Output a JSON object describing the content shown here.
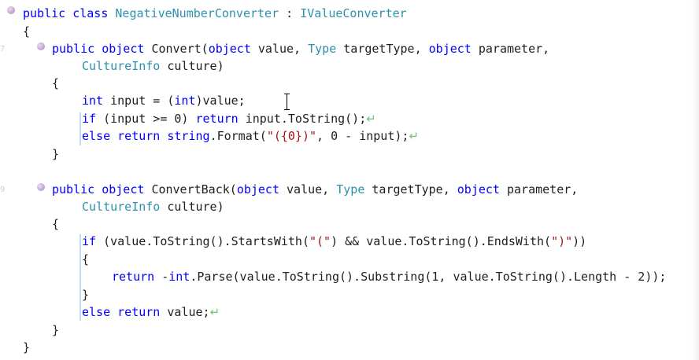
{
  "editor": {
    "line_numbers": [
      "7",
      "9"
    ],
    "tokens": {
      "public": "public",
      "class": "class",
      "class_name": "NegativeNumberConverter",
      "colon": " : ",
      "interface_name": "IValueConverter",
      "brace_open": "{",
      "brace_close": "}",
      "object": "object",
      "convert_name": "Convert(",
      "convert_back_name": "ConvertBack(",
      "type": "Type",
      "culture_info": "CultureInfo",
      "value_comma": " value, ",
      "target_type_comma": " targetType, ",
      "parameter_comma": " parameter,",
      "culture_close": " culture)",
      "int": "int",
      "input_assign": " input = (",
      "int_cast_close": ")value;",
      "if": "if",
      "input_ge_zero": " (input >= 0) ",
      "return": "return",
      "input_tostring": " input.ToString();",
      "else": "else",
      "string": "string",
      "format_open": ".Format(",
      "format_string": "\"({0})\"",
      "format_rest": ", 0 - input);",
      "if_starts_with": " (value.ToString().StartsWith(",
      "open_paren_string": "\"(\"",
      "ends_with": ") && value.ToString().EndsWith(",
      "close_paren_string": "\")\"",
      "double_close": "))",
      "neg": " -",
      "parse_call": ".Parse(value.ToString().Substring(1, value.ToString().Length - 2));",
      "value_semicolon": " value;",
      "return_arrow": "↵"
    }
  }
}
